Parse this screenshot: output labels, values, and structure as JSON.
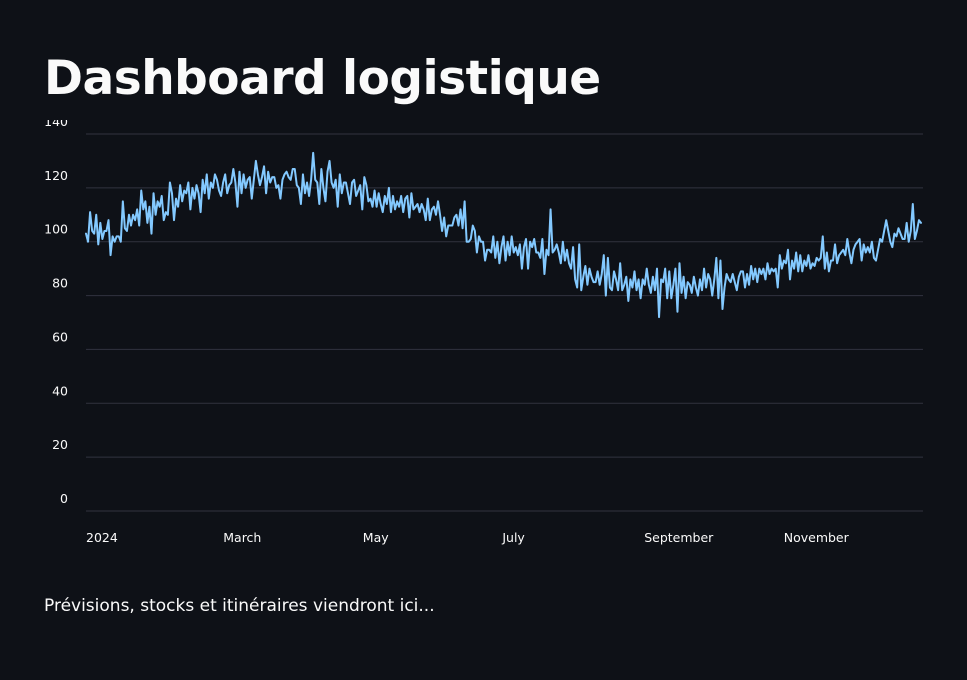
{
  "page": {
    "title": "Dashboard logistique",
    "caption": "Prévisions, stocks et itinéraires viendront ici..."
  },
  "colors": {
    "background": "#0e1117",
    "line": "#83c9ff",
    "grid": "#31333f",
    "text": "#fafafa"
  },
  "chart_data": {
    "type": "line",
    "title": "",
    "xlabel": "",
    "ylabel": "",
    "x_start": "2024-01-01",
    "x_end": "2024-12-31",
    "ylim": [
      0,
      140
    ],
    "y_ticks": [
      0,
      20,
      40,
      60,
      80,
      100,
      120,
      140
    ],
    "x_ticks": [
      {
        "date": "2024-01-01",
        "label": "2024"
      },
      {
        "date": "2024-03-01",
        "label": "March"
      },
      {
        "date": "2024-05-01",
        "label": "May"
      },
      {
        "date": "2024-07-01",
        "label": "July"
      },
      {
        "date": "2024-09-01",
        "label": "September"
      },
      {
        "date": "2024-11-01",
        "label": "November"
      }
    ],
    "grid": true,
    "legend": "none",
    "series": [
      {
        "values": [
          103,
          100,
          111,
          104,
          103,
          110,
          99,
          107,
          101,
          104,
          104,
          108,
          95,
          102,
          100,
          102,
          102,
          100,
          115,
          105,
          104,
          110,
          106,
          110,
          108,
          112,
          106,
          119,
          112,
          115,
          107,
          113,
          103,
          118,
          110,
          115,
          113,
          117,
          108,
          111,
          110,
          122,
          118,
          108,
          116,
          113,
          121,
          115,
          119,
          118,
          122,
          112,
          120,
          116,
          121,
          118,
          111,
          123,
          118,
          125,
          116,
          122,
          120,
          125,
          123,
          119,
          117,
          122,
          125,
          118,
          121,
          122,
          127,
          122,
          113,
          126,
          118,
          125,
          120,
          123,
          124,
          116,
          123,
          130,
          125,
          121,
          124,
          128,
          118,
          126,
          122,
          124,
          124,
          120,
          121,
          116,
          123,
          125,
          126,
          124,
          123,
          127,
          127,
          121,
          120,
          114,
          125,
          118,
          122,
          117,
          123,
          133,
          123,
          122,
          114,
          127,
          120,
          115,
          126,
          130,
          122,
          120,
          123,
          113,
          125,
          118,
          122,
          122,
          118,
          114,
          122,
          123,
          117,
          119,
          121,
          112,
          124,
          121,
          115,
          116,
          113,
          119,
          113,
          118,
          114,
          111,
          117,
          114,
          120,
          111,
          117,
          112,
          115,
          113,
          117,
          111,
          116,
          117,
          109,
          118,
          112,
          113,
          114,
          111,
          114,
          112,
          108,
          116,
          108,
          112,
          113,
          110,
          115,
          110,
          104,
          109,
          102,
          106,
          106,
          106,
          109,
          110,
          106,
          112,
          105,
          115,
          100,
          100,
          101,
          106,
          104,
          96,
          102,
          100,
          100,
          93,
          97,
          97,
          96,
          102,
          94,
          100,
          92,
          98,
          102,
          93,
          100,
          95,
          102,
          96,
          98,
          95,
          99,
          90,
          98,
          101,
          90,
          100,
          98,
          101,
          96,
          96,
          94,
          101,
          88,
          97,
          95,
          112,
          96,
          97,
          99,
          96,
          92,
          100,
          93,
          97,
          92,
          90,
          98,
          86,
          83,
          99,
          82,
          87,
          91,
          84,
          90,
          87,
          85,
          85,
          89,
          84,
          88,
          95,
          80,
          94,
          83,
          82,
          89,
          86,
          82,
          92,
          82,
          84,
          87,
          78,
          86,
          83,
          89,
          82,
          86,
          79,
          86,
          84,
          90,
          84,
          81,
          87,
          82,
          90,
          72,
          86,
          85,
          90,
          79,
          89,
          79,
          84,
          90,
          74,
          92,
          81,
          87,
          79,
          85,
          84,
          81,
          87,
          83,
          80,
          86,
          82,
          90,
          83,
          88,
          86,
          80,
          86,
          94,
          79,
          93,
          75,
          83,
          88,
          86,
          85,
          88,
          85,
          82,
          87,
          89,
          89,
          83,
          88,
          84,
          91,
          86,
          90,
          85,
          90,
          88,
          90,
          86,
          92,
          88,
          90,
          89,
          90,
          83,
          95,
          90,
          93,
          92,
          97,
          86,
          93,
          90,
          96,
          89,
          95,
          89,
          93,
          91,
          95,
          90,
          92,
          91,
          94,
          93,
          94,
          102,
          90,
          96,
          89,
          93,
          93,
          99,
          92,
          95,
          96,
          97,
          95,
          101,
          96,
          92,
          97,
          99,
          100,
          101,
          93,
          99,
          96,
          98,
          96,
          100,
          94,
          93,
          97,
          101,
          100,
          104,
          108,
          104,
          100,
          98,
          103,
          102,
          105,
          103,
          101,
          101,
          107,
          100,
          104,
          114,
          101,
          104,
          108,
          107
        ]
      }
    ]
  }
}
